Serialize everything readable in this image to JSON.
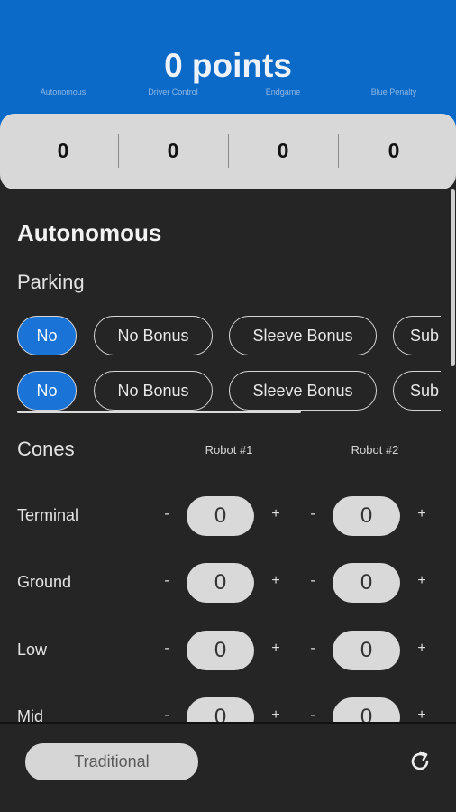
{
  "header": {
    "total": "0 points",
    "categories": [
      "Autonomous",
      "Driver Control",
      "Endgame",
      "Blue Penalty"
    ],
    "scores": [
      "0",
      "0",
      "0",
      "0"
    ]
  },
  "autonomous": {
    "title": "Autonomous",
    "parking": {
      "label": "Parking",
      "options": [
        "No",
        "No Bonus",
        "Sleeve Bonus",
        "Sub"
      ],
      "robot1_selected": "No",
      "robot2_selected": "No"
    },
    "cones": {
      "label": "Cones",
      "robot_headers": [
        "Robot #1",
        "Robot #2"
      ],
      "minus": "-",
      "plus": "+",
      "rows": [
        {
          "name": "Terminal",
          "robot1": "0",
          "robot2": "0"
        },
        {
          "name": "Ground",
          "robot1": "0",
          "robot2": "0"
        },
        {
          "name": "Low",
          "robot1": "0",
          "robot2": "0"
        },
        {
          "name": "Mid",
          "robot1": "0",
          "robot2": "0"
        }
      ]
    }
  },
  "footer": {
    "mode_label": "Traditional",
    "refresh_icon": "refresh-icon"
  },
  "colors": {
    "header_blue": "#0b69c7",
    "selected_chip": "#1a73d6",
    "panel_bg": "#252525"
  }
}
